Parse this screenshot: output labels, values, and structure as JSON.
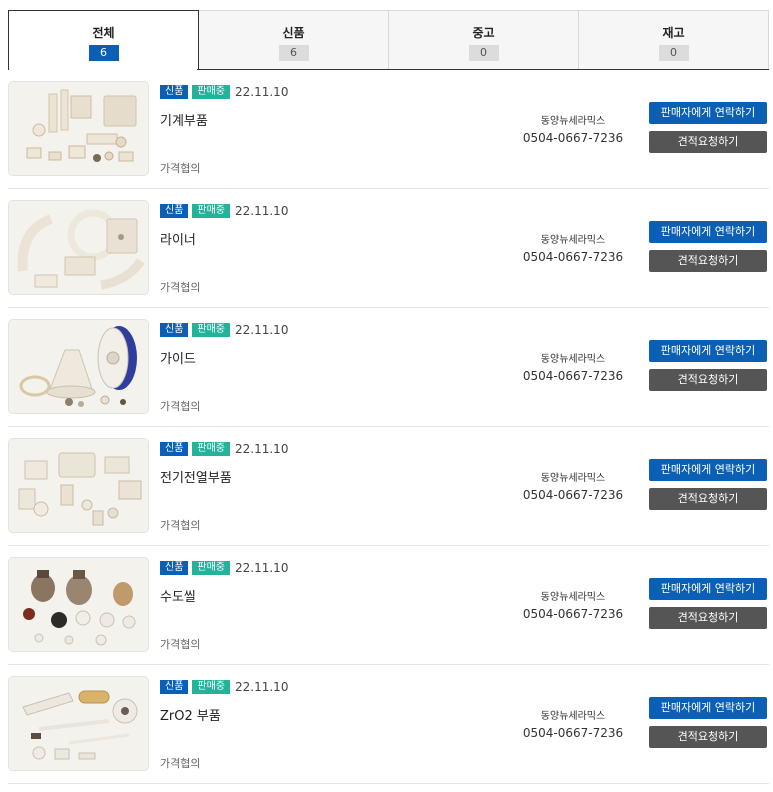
{
  "tabs": [
    {
      "label": "전체",
      "count": "6",
      "active": true
    },
    {
      "label": "신품",
      "count": "6",
      "active": false
    },
    {
      "label": "중고",
      "count": "0",
      "active": false
    },
    {
      "label": "재고",
      "count": "0",
      "active": false
    }
  ],
  "products": [
    {
      "badge_new": "신품",
      "badge_status": "판매중",
      "date": "22.11.10",
      "name": "기계부품",
      "price": "가격협의",
      "seller": "동양뉴세라믹스",
      "phone": "0504-0667-7236",
      "contact_label": "판매자에게 연락하기",
      "quote_label": "견적요청하기"
    },
    {
      "badge_new": "신품",
      "badge_status": "판매중",
      "date": "22.11.10",
      "name": "라이너",
      "price": "가격협의",
      "seller": "동양뉴세라믹스",
      "phone": "0504-0667-7236",
      "contact_label": "판매자에게 연락하기",
      "quote_label": "견적요청하기"
    },
    {
      "badge_new": "신품",
      "badge_status": "판매중",
      "date": "22.11.10",
      "name": "가이드",
      "price": "가격협의",
      "seller": "동양뉴세라믹스",
      "phone": "0504-0667-7236",
      "contact_label": "판매자에게 연락하기",
      "quote_label": "견적요청하기"
    },
    {
      "badge_new": "신품",
      "badge_status": "판매중",
      "date": "22.11.10",
      "name": "전기전열부품",
      "price": "가격협의",
      "seller": "동양뉴세라믹스",
      "phone": "0504-0667-7236",
      "contact_label": "판매자에게 연락하기",
      "quote_label": "견적요청하기"
    },
    {
      "badge_new": "신품",
      "badge_status": "판매중",
      "date": "22.11.10",
      "name": "수도씰",
      "price": "가격협의",
      "seller": "동양뉴세라믹스",
      "phone": "0504-0667-7236",
      "contact_label": "판매자에게 연락하기",
      "quote_label": "견적요청하기"
    },
    {
      "badge_new": "신품",
      "badge_status": "판매중",
      "date": "22.11.10",
      "name": "ZrO2 부품",
      "price": "가격협의",
      "seller": "동양뉴세라믹스",
      "phone": "0504-0667-7236",
      "contact_label": "판매자에게 연락하기",
      "quote_label": "견적요청하기"
    }
  ],
  "colors": {
    "accent": "#0b5fb5",
    "status": "#22b39a",
    "button_dark": "#555555"
  }
}
